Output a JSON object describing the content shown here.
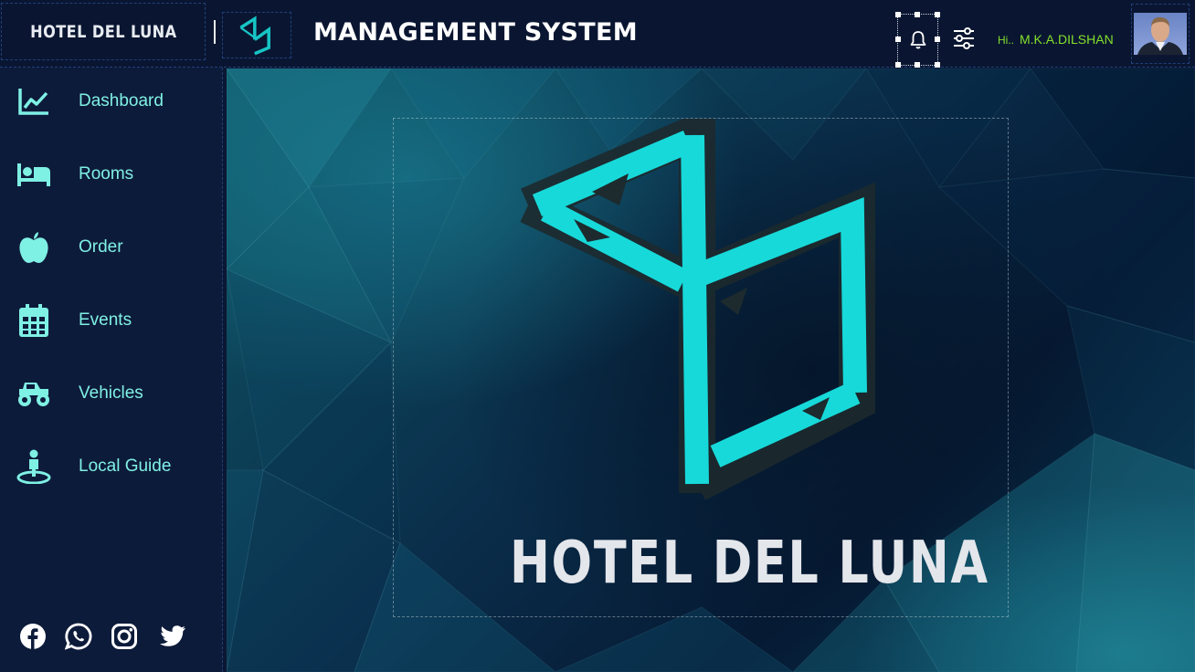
{
  "header": {
    "brand": "HOTEL DEL LUNA",
    "title": "MANAGEMENT SYSTEM",
    "greeting_prefix": "Hi..",
    "user_name": "M.K.A.DILSHAN",
    "icons": [
      "bell-icon",
      "sliders-icon"
    ]
  },
  "sidebar": {
    "items": [
      {
        "label": "Dashboard",
        "icon": "chart-line-icon"
      },
      {
        "label": "Rooms",
        "icon": "bed-icon"
      },
      {
        "label": "Order",
        "icon": "apple-icon"
      },
      {
        "label": "Events",
        "icon": "calendar-icon"
      },
      {
        "label": "Vehicles",
        "icon": "monster-truck-icon"
      },
      {
        "label": "Local Guide",
        "icon": "person-pin-icon"
      }
    ],
    "social": [
      "facebook-icon",
      "whatsapp-icon",
      "instagram-icon",
      "twitter-icon"
    ]
  },
  "main": {
    "logo_text": "HOTEL DEL LUNA"
  },
  "colors": {
    "accent": "#7ff0e4",
    "logo_cyan": "#17d9d9",
    "greeting": "#84e02c",
    "bg_dark": "#0b1733"
  }
}
